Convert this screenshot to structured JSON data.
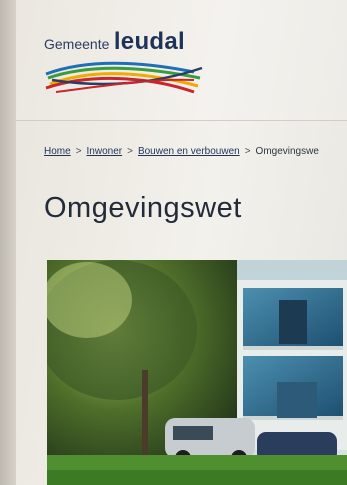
{
  "header": {
    "logo": {
      "prefix": "Gemeente",
      "name": "leudal",
      "swoosh_colors": [
        "#c8262d",
        "#f2a900",
        "#3c9b3a",
        "#1e6fb5",
        "#2b3d63"
      ]
    }
  },
  "breadcrumb": {
    "items": [
      "Home",
      "Inwoner",
      "Bouwen en verbouwen"
    ],
    "current": "Omgevingswe",
    "separator": ">"
  },
  "main": {
    "title": "Omgevingswet"
  },
  "colors": {
    "brand": "#1f3359",
    "background": "#f1efea"
  }
}
